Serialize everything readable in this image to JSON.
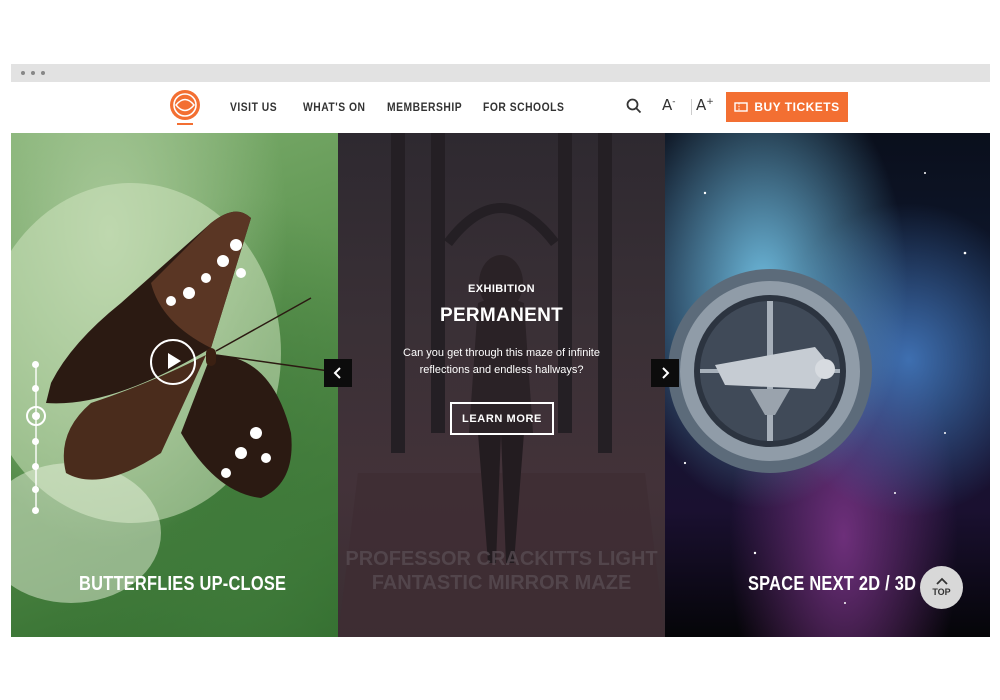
{
  "nav": {
    "links": [
      "VISIT US",
      "WHAT'S ON",
      "MEMBERSHIP",
      "FOR SCHOOLS"
    ],
    "font_decrease": "A",
    "font_increase": "A",
    "buy_label": "BUY TICKETS"
  },
  "panels": {
    "left": {
      "title": "BUTTERFLIES UP-CLOSE"
    },
    "center": {
      "eyebrow": "EXHIBITION",
      "title": "PERMANENT",
      "description": "Can you get through this maze of infinite reflections and endless hallways?",
      "cta": "LEARN MORE",
      "name_line1": "PROFESSOR CRACKITTS LIGHT",
      "name_line2": "FANTASTIC MIRROR MAZE"
    },
    "right": {
      "title": "SPACE NEXT 2D / 3D"
    }
  },
  "top_button": "TOP",
  "colors": {
    "accent": "#f36f32",
    "nav_bg": "#ffffff"
  },
  "icons": [
    "logo",
    "search-icon",
    "ticket-icon",
    "play-icon",
    "chevron-left-icon",
    "chevron-right-icon",
    "chevron-up-icon"
  ]
}
